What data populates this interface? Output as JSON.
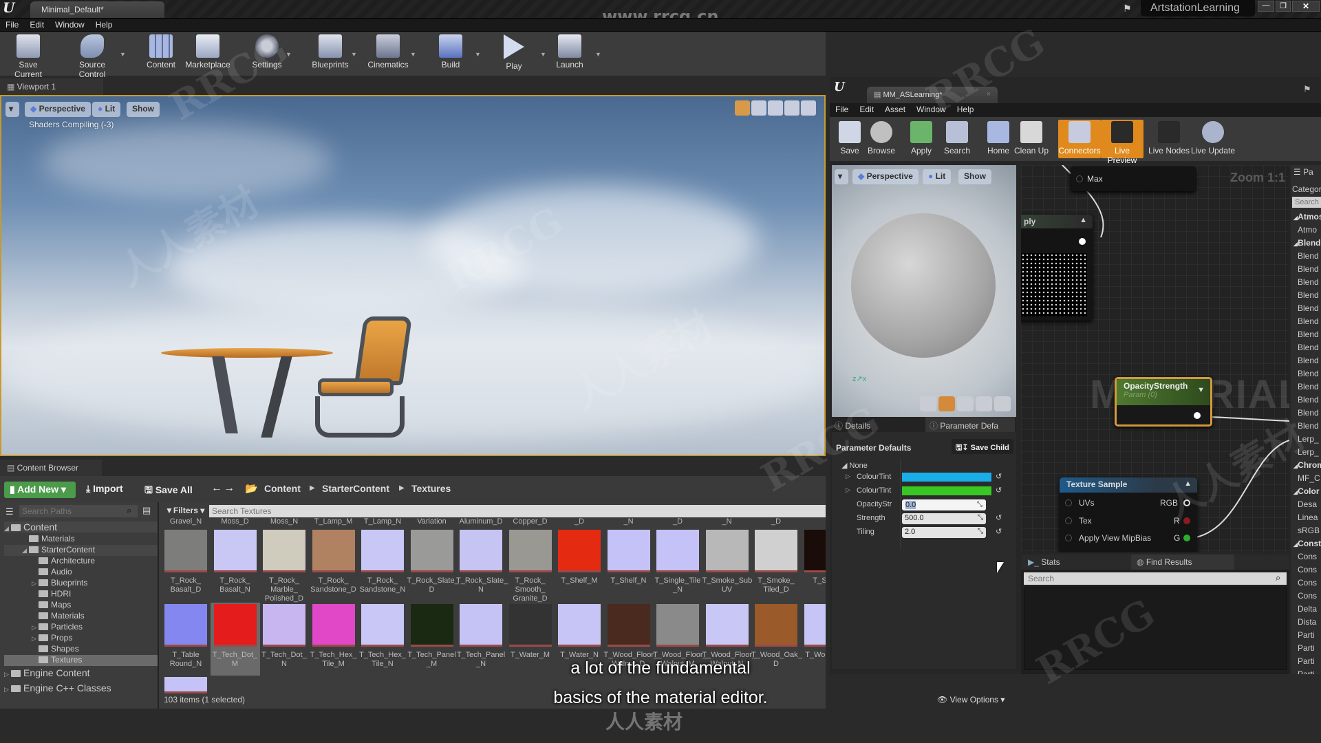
{
  "main_window": {
    "tab_title": "Minimal_Default*",
    "user": "ArtstationLearning",
    "watermark_url": "www.rrcg.cn",
    "menu": [
      "File",
      "Edit",
      "Window",
      "Help"
    ],
    "toolbar": [
      {
        "label": "Save Current",
        "icon": "save-icon"
      },
      {
        "label": "Source Control",
        "icon": "source-control-icon"
      },
      {
        "label": "Content",
        "icon": "content-icon"
      },
      {
        "label": "Marketplace",
        "icon": "marketplace-icon"
      },
      {
        "label": "Settings",
        "icon": "settings-icon"
      },
      {
        "label": "Blueprints",
        "icon": "blueprints-icon"
      },
      {
        "label": "Cinematics",
        "icon": "cinematics-icon"
      },
      {
        "label": "Build",
        "icon": "build-icon"
      },
      {
        "label": "Play",
        "icon": "play-icon"
      },
      {
        "label": "Launch",
        "icon": "launch-icon"
      }
    ]
  },
  "viewport": {
    "tab": "Viewport 1",
    "perspective": "Perspective",
    "lit": "Lit",
    "show": "Show",
    "status": "Shaders Compiling (-3)"
  },
  "content_browser": {
    "tab": "Content Browser",
    "add_new": "Add New",
    "import": "Import",
    "save_all": "Save All",
    "breadcrumb": [
      "Content",
      "StarterContent",
      "Textures"
    ],
    "search_paths_placeholder": "Search Paths",
    "filters": "Filters",
    "search_placeholder": "Search Textures",
    "tree": [
      {
        "label": "Content",
        "level": 0,
        "expanded": true
      },
      {
        "label": "Materials",
        "level": 1
      },
      {
        "label": "StarterContent",
        "level": 1,
        "expanded": true
      },
      {
        "label": "Architecture",
        "level": 2
      },
      {
        "label": "Audio",
        "level": 2
      },
      {
        "label": "Blueprints",
        "level": 2,
        "collapsed": true
      },
      {
        "label": "HDRI",
        "level": 2
      },
      {
        "label": "Maps",
        "level": 2
      },
      {
        "label": "Materials",
        "level": 2
      },
      {
        "label": "Particles",
        "level": 2,
        "collapsed": true
      },
      {
        "label": "Props",
        "level": 2,
        "collapsed": true
      },
      {
        "label": "Shapes",
        "level": 2
      },
      {
        "label": "Textures",
        "level": 2,
        "selected": true
      },
      {
        "label": "Engine Content",
        "level": 0,
        "collapsed": true
      },
      {
        "label": "Engine C++ Classes",
        "level": 0,
        "collapsed": true
      }
    ],
    "top_partial_labels": [
      "Gravel_N",
      "Moss_D",
      "Moss_N",
      "T_Lamp_M",
      "T_Lamp_N",
      "Variation",
      "Aluminum_D",
      "Copper_D",
      "_D",
      "_N",
      "_D",
      "_N",
      "_D"
    ],
    "row1": [
      {
        "label": "T_Rock_ Basalt_D",
        "color": "#7d7d7b"
      },
      {
        "label": "T_Rock_ Basalt_N",
        "color": "#c9c8f5"
      },
      {
        "label": "T_Rock_ Marble_ Polished_D",
        "color": "#cfcbbd"
      },
      {
        "label": "T_Rock_ Sandstone_D",
        "color": "#b08262"
      },
      {
        "label": "T_Rock_ Sandstone_N",
        "color": "#c9c7f6"
      },
      {
        "label": "T_Rock_Slate_ D",
        "color": "#9a9a98"
      },
      {
        "label": "T_Rock_Slate_ N",
        "color": "#c6c4f3"
      },
      {
        "label": "T_Rock_ Smooth_ Granite_D",
        "color": "#999893"
      },
      {
        "label": "T_Shelf_M",
        "color": "#e52a12"
      },
      {
        "label": "T_Shelf_N",
        "color": "#c4c2f7"
      },
      {
        "label": "T_Single_Tile _N",
        "color": "#c4c2f7"
      },
      {
        "label": "T_Smoke_Sub UV",
        "color": "#b8b8b8"
      },
      {
        "label": "T_Smoke_ Tiled_D",
        "color": "#d0d0d0"
      },
      {
        "label": "T_Spar",
        "color": "#1a0c08"
      }
    ],
    "row2": [
      {
        "label": "T_Table Round_N",
        "color": "#8487f0"
      },
      {
        "label": "T_Tech_Dot_ M",
        "color": "#e51c1c",
        "selected": true
      },
      {
        "label": "T_Tech_Dot_ N",
        "color": "#c7b6f0"
      },
      {
        "label": "T_Tech_Hex_ Tile_M",
        "color": "#e048c8"
      },
      {
        "label": "T_Tech_Hex_ Tile_N",
        "color": "#c9c7f5"
      },
      {
        "label": "T_Tech_Panel _M",
        "color": "#1a2a12"
      },
      {
        "label": "T_Tech_Panel _N",
        "color": "#c5c3f6"
      },
      {
        "label": "T_Water_M",
        "color": "#333333"
      },
      {
        "label": "T_Water_N",
        "color": "#c7c5f6"
      },
      {
        "label": "T_Wood_Floor_ Walnut_D",
        "color": "#4a2a1e"
      },
      {
        "label": "T_Wood_Floor_ Walnut_M",
        "color": "#8a8a8a"
      },
      {
        "label": "T_Wood_Floor_ Walnut_N",
        "color": "#c9c7f6"
      },
      {
        "label": "T_Wood_Oak_ D",
        "color": "#9a5a2a"
      },
      {
        "label": "T_Wood_ N",
        "color": "#c7c5f6"
      }
    ],
    "status": "103 items (1 selected)",
    "view_options": "View Options"
  },
  "material_editor": {
    "tab_title": "MM_ASLearning*",
    "menu": [
      "File",
      "Edit",
      "Asset",
      "Window",
      "Help"
    ],
    "toolbar": [
      {
        "label": "Save",
        "icon": "save-icon",
        "active": false
      },
      {
        "label": "Browse",
        "icon": "browse-icon",
        "active": false
      },
      {
        "label": "Apply",
        "icon": "apply-checkmark-icon",
        "active": false
      },
      {
        "label": "Search",
        "icon": "binoculars-icon",
        "active": false
      },
      {
        "label": "Home",
        "icon": "home-icon",
        "active": false
      },
      {
        "label": "Clean Up",
        "icon": "broom-icon",
        "active": false
      },
      {
        "label": "Connectors",
        "icon": "connectors-icon",
        "active": true
      },
      {
        "label": "Live Preview",
        "icon": "live-preview-icon",
        "active": true
      },
      {
        "label": "Live Nodes",
        "icon": "live-nodes-icon",
        "active": false
      },
      {
        "label": "Live Update",
        "icon": "live-update-icon",
        "active": false
      }
    ],
    "preview": {
      "perspective": "Perspective",
      "lit": "Lit",
      "show": "Show"
    },
    "details_tab": "Details",
    "param_tab": "Parameter Defa",
    "param_header": "Parameter Defaults",
    "save_child": "Save Child",
    "group": "None",
    "params": [
      {
        "name": "ColourTint",
        "type": "color",
        "color": "#1aaee8"
      },
      {
        "name": "ColourTint",
        "type": "color",
        "color": "#39c724"
      },
      {
        "name": "OpacityStr",
        "type": "number",
        "value": "0.0",
        "editing": true
      },
      {
        "name": "Strength",
        "type": "number",
        "value": "500.0"
      },
      {
        "name": "Tiling",
        "type": "number",
        "value": "2.0"
      }
    ],
    "graph": {
      "zoom": "Zoom 1:1",
      "watermark": "MATERIAL",
      "node_max": "Max",
      "node_multiply": "ply",
      "opacity_node": {
        "title": "OpacityStrength",
        "sub": "Param (0)"
      },
      "texture_node": {
        "title": "Texture Sample",
        "inputs": [
          "UVs",
          "Tex",
          "Apply View MipBias"
        ],
        "outputs": [
          "RGB",
          "R",
          "G"
        ]
      }
    },
    "stats_tab": "Stats",
    "find_tab": "Find Results",
    "find_search_placeholder": "Search",
    "palette": {
      "title": "Pa",
      "category": "Categor",
      "search_placeholder": "Search",
      "items": [
        {
          "label": "Atmos",
          "cat": true
        },
        {
          "label": "Atmo"
        },
        {
          "label": "Blend",
          "cat": true
        },
        {
          "label": "Blend"
        },
        {
          "label": "Blend"
        },
        {
          "label": "Blend"
        },
        {
          "label": "Blend"
        },
        {
          "label": "Blend"
        },
        {
          "label": "Blend"
        },
        {
          "label": "Blend"
        },
        {
          "label": "Blend"
        },
        {
          "label": "Blend"
        },
        {
          "label": "Blend"
        },
        {
          "label": "Blend"
        },
        {
          "label": "Blend"
        },
        {
          "label": "Blend"
        },
        {
          "label": "Blend"
        },
        {
          "label": "Lerp_"
        },
        {
          "label": "Lerp_"
        },
        {
          "label": "Chrom",
          "cat": true
        },
        {
          "label": "MF_C"
        },
        {
          "label": "Color",
          "cat": true
        },
        {
          "label": "Desa"
        },
        {
          "label": "Linea"
        },
        {
          "label": "sRGB"
        },
        {
          "label": "Const",
          "cat": true
        },
        {
          "label": "Cons"
        },
        {
          "label": "Cons"
        },
        {
          "label": "Cons"
        },
        {
          "label": "Cons"
        },
        {
          "label": "Delta"
        },
        {
          "label": "Dista"
        },
        {
          "label": "Parti"
        },
        {
          "label": "Parti"
        },
        {
          "label": "Parti"
        },
        {
          "label": "Parti"
        }
      ]
    }
  },
  "subtitle": [
    "a lot of the fundamental",
    "basics of the material editor."
  ],
  "watermarks": [
    "RRCG",
    "人人素材"
  ]
}
